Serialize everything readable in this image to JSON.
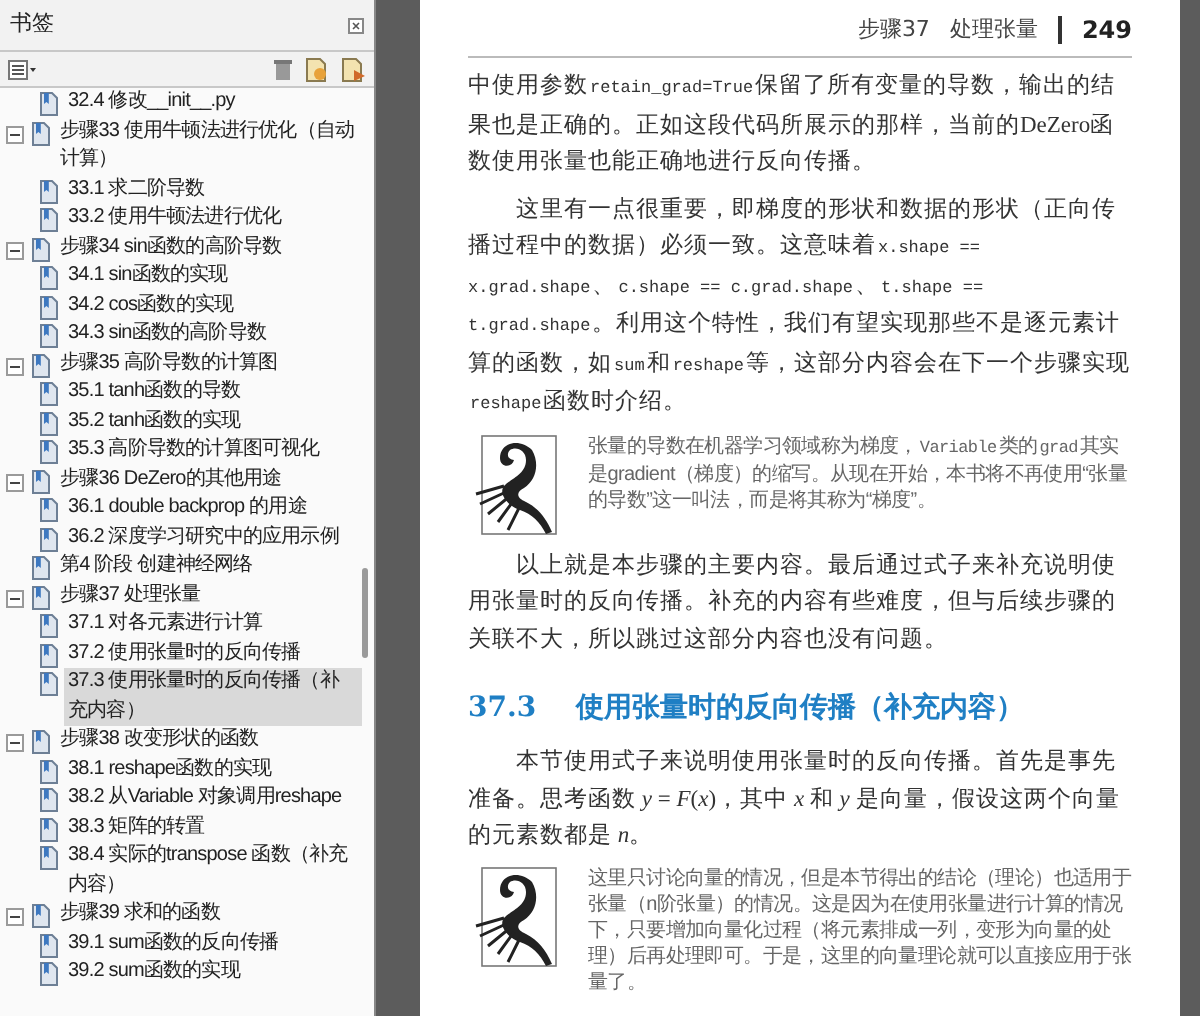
{
  "sidebar": {
    "title": "书签",
    "items": [
      {
        "children": [
          {
            "label": "32.4 修改__init__.py",
            "selected": false
          }
        ]
      },
      {
        "label": "步骤33 使用牛顿法进行优化（自动计算）",
        "expanded": true,
        "selected": false,
        "children": [
          {
            "label": "33.1 求二阶导数",
            "selected": false
          },
          {
            "label": "33.2 使用牛顿法进行优化",
            "selected": false
          }
        ]
      },
      {
        "label": "步骤34 sin函数的高阶导数",
        "expanded": true,
        "selected": false,
        "children": [
          {
            "label": "34.1 sin函数的实现",
            "selected": false
          },
          {
            "label": "34.2 cos函数的实现",
            "selected": false
          },
          {
            "label": "34.3 sin函数的高阶导数",
            "selected": false
          }
        ]
      },
      {
        "label": "步骤35 高阶导数的计算图",
        "expanded": true,
        "selected": false,
        "children": [
          {
            "label": "35.1 tanh函数的导数",
            "selected": false
          },
          {
            "label": "35.2 tanh函数的实现",
            "selected": false
          },
          {
            "label": "35.3 高阶导数的计算图可视化",
            "selected": false
          }
        ]
      },
      {
        "label": "步骤36 DeZero的其他用途",
        "expanded": true,
        "selected": false,
        "children": [
          {
            "label": "36.1 double backprop 的用途",
            "selected": false
          },
          {
            "label": "36.2 深度学习研究中的应用示例",
            "selected": false
          }
        ]
      },
      {
        "label": "第4 阶段 创建神经网络",
        "selected": false
      },
      {
        "label": "步骤37 处理张量",
        "expanded": true,
        "selected": false,
        "children": [
          {
            "label": "37.1 对各元素进行计算",
            "selected": false
          },
          {
            "label": "37.2 使用张量时的反向传播",
            "selected": false
          },
          {
            "label": "37.3 使用张量时的反向传播（补充内容）",
            "selected": true
          }
        ]
      },
      {
        "label": "步骤38 改变形状的函数",
        "expanded": true,
        "selected": false,
        "children": [
          {
            "label": "38.1 reshape函数的实现",
            "selected": false
          },
          {
            "label": "38.2 从Variable 对象调用reshape",
            "selected": false
          },
          {
            "label": "38.3 矩阵的转置",
            "selected": false
          },
          {
            "label": "38.4 实际的transpose 函数（补充内容）",
            "selected": false
          }
        ]
      },
      {
        "label": "步骤39 求和的函数",
        "expanded": true,
        "selected": false,
        "children": [
          {
            "label": "39.1 sum函数的反向传播",
            "selected": false
          },
          {
            "label": "39.2 sum函数的实现",
            "selected": false
          }
        ]
      }
    ]
  },
  "page": {
    "header": {
      "chapter": "步骤37",
      "title": "处理张量",
      "number": "249"
    },
    "blocks": [
      {
        "kind": "paragraph",
        "indent": false,
        "segments": [
          {
            "kind": "text",
            "text": "中使用参数"
          },
          {
            "kind": "code",
            "text": "retain_grad=True"
          },
          {
            "kind": "text",
            "text": "保留了所有变量的导数，输出的结果也是正确的。正如这段代码所展示的那样，当前的DeZero函数使用张量也能正确地进行反向传播。"
          }
        ]
      },
      {
        "kind": "paragraph",
        "indent": true,
        "segments": [
          {
            "kind": "text",
            "text": "这里有一点很重要，即梯度的形状和数据的形状（正向传播过程中的数据）必须一致。这意味着"
          },
          {
            "kind": "code",
            "text": "x.shape == x.grad.shape"
          },
          {
            "kind": "text",
            "text": "、"
          },
          {
            "kind": "code",
            "text": "c.shape == c.grad.shape"
          },
          {
            "kind": "text",
            "text": "、"
          },
          {
            "kind": "code",
            "text": "t.shape == t.grad.shape"
          },
          {
            "kind": "text",
            "text": "。利用这个特性，我们有望实现那些不是逐元素计算的函数，如"
          },
          {
            "kind": "code",
            "text": "sum"
          },
          {
            "kind": "text",
            "text": "和"
          },
          {
            "kind": "code",
            "text": "reshape"
          },
          {
            "kind": "text",
            "text": "等，这部分内容会在下一个步骤实现"
          },
          {
            "kind": "code",
            "text": "reshape"
          },
          {
            "kind": "text",
            "text": "函数时介绍。"
          }
        ]
      },
      {
        "kind": "note",
        "segments": [
          {
            "kind": "text",
            "text": "张量的导数在机器学习领域称为梯度，"
          },
          {
            "kind": "code",
            "text": "Variable"
          },
          {
            "kind": "text",
            "text": "类的"
          },
          {
            "kind": "code",
            "text": "grad"
          },
          {
            "kind": "text",
            "text": "其实是gradient（梯度）的缩写。从现在开始，本书将不再使用“张量的导数”这一叫法，而是将其称为“梯度”。"
          }
        ]
      },
      {
        "kind": "paragraph",
        "indent": true,
        "segments": [
          {
            "kind": "text",
            "text": "以上就是本步骤的主要内容。最后通过式子来补充说明使用张量时的反向传播。补充的内容有些难度，但与后续步骤的关联不大，所以跳过这部分内容也没有问题。"
          }
        ]
      },
      {
        "kind": "heading",
        "number": "37.3",
        "title": "使用张量时的反向传播（补充内容）"
      },
      {
        "kind": "paragraph",
        "indent": true,
        "segments": [
          {
            "kind": "math",
            "text": "本节使用式子来说明使用张量时的反向传播。首先是事先准备。思考函数 *y* = *F*(*x*)，其中 *x* 和 *y* 是向量，假设这两个向量的元素数都是 *n*。"
          }
        ]
      },
      {
        "kind": "note",
        "segments": [
          {
            "kind": "text",
            "text": "这里只讨论向量的情况，但是本节得出的结论（理论）也适用于张量（n阶张量）的情况。这是因为在使用张量进行计算的情况下，只要增加向量化过程（将元素排成一列，变形为向量的处理）后再处理即可。于是，这里的向量理论就可以直接应用于张量了。"
          }
        ]
      }
    ]
  }
}
